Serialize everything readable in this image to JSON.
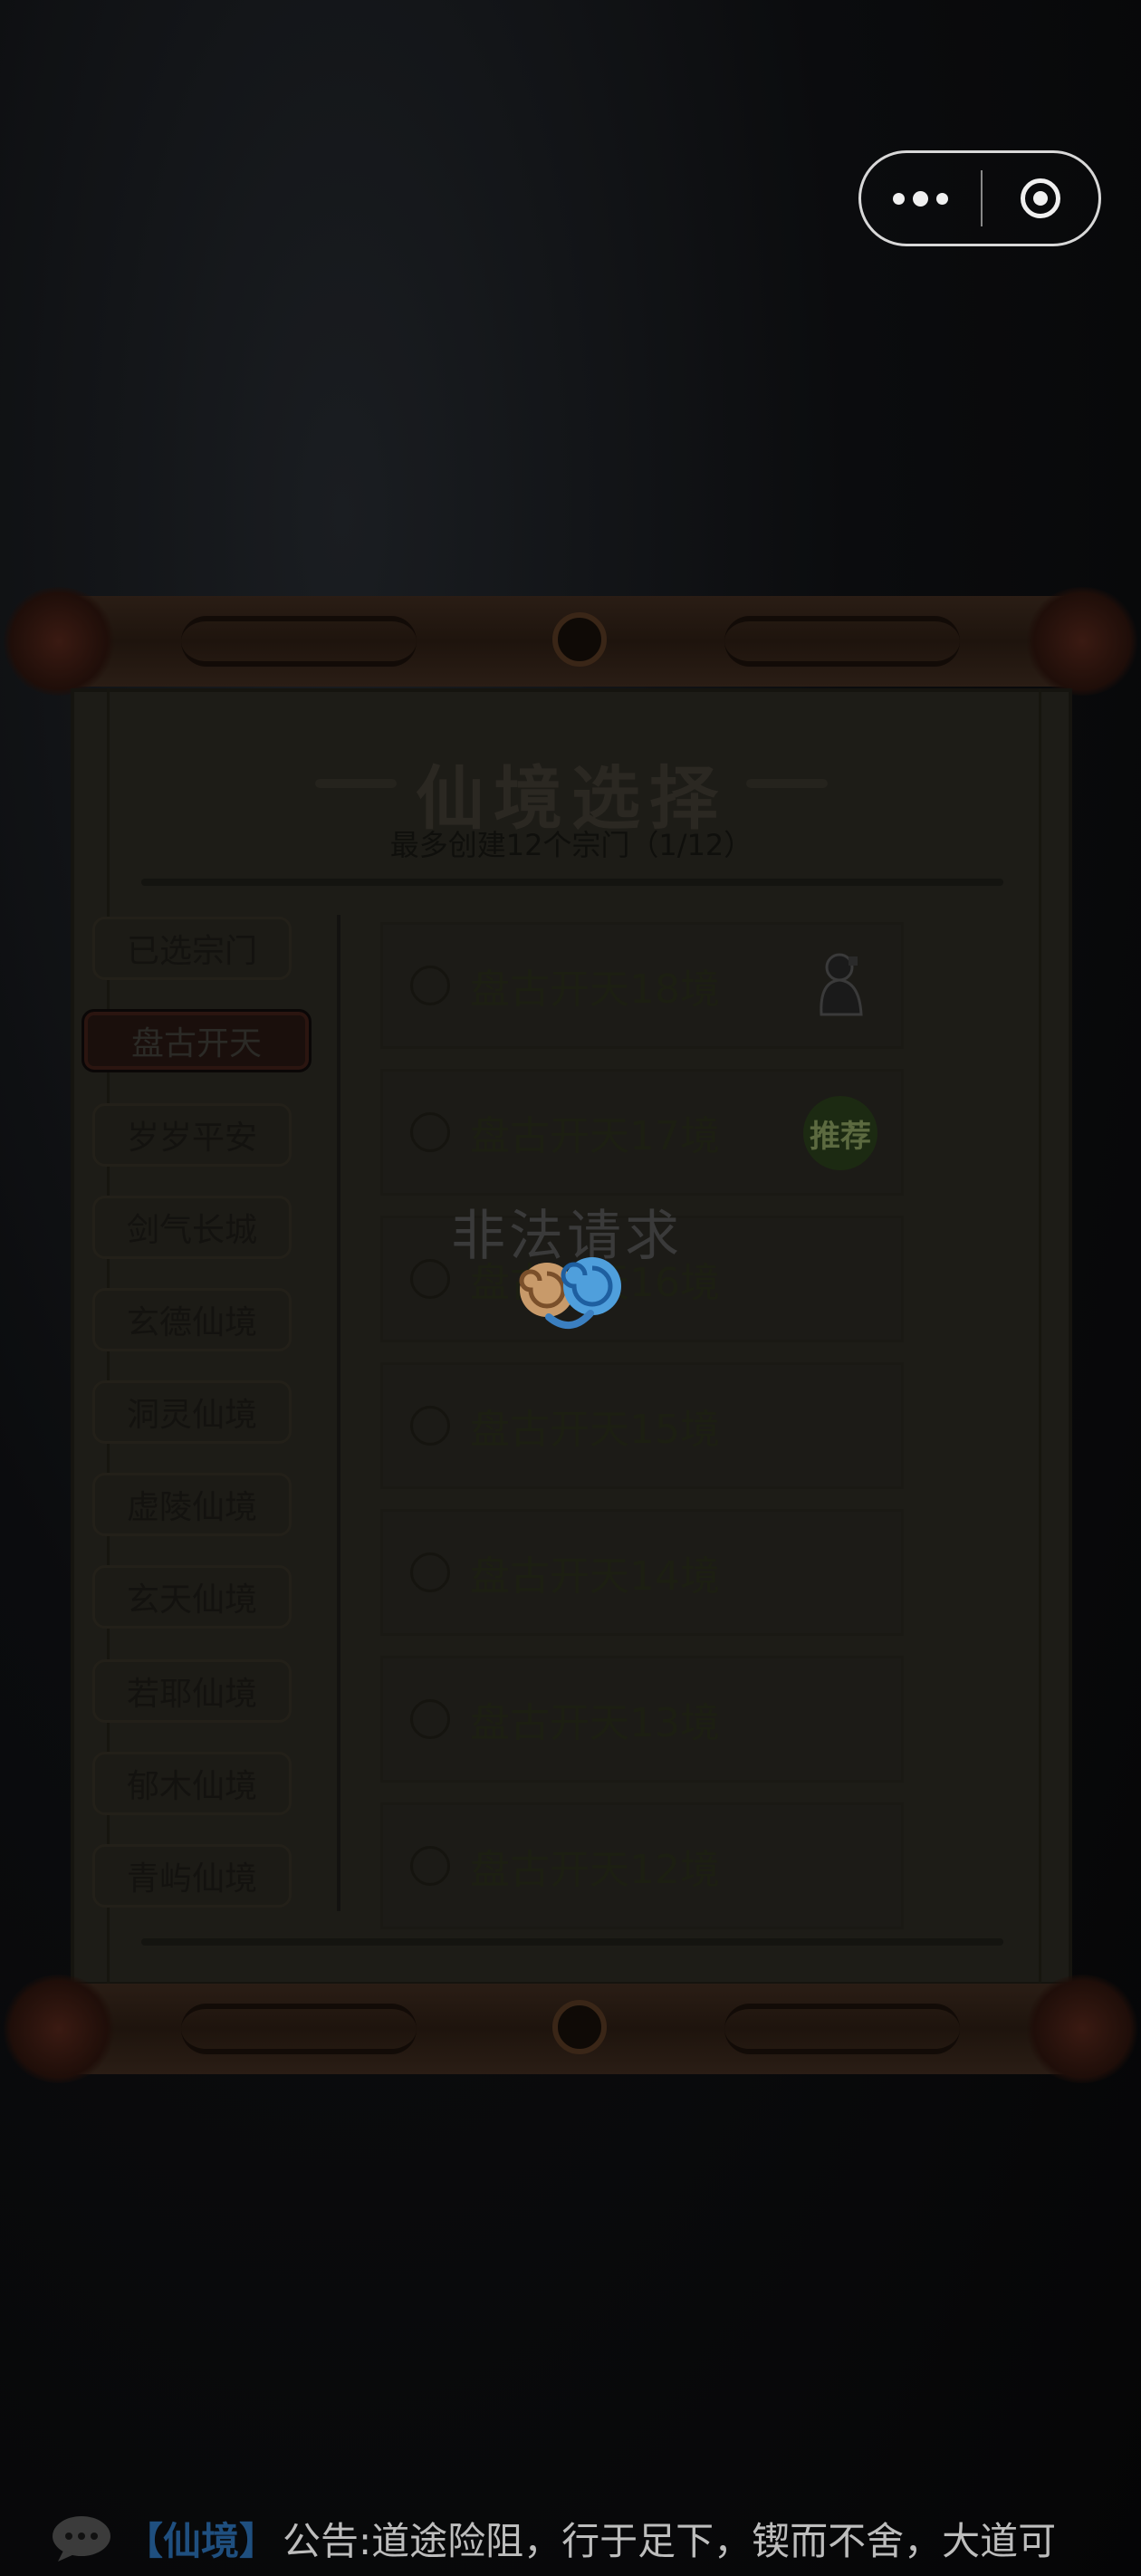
{
  "panel": {
    "title": "仙境选择",
    "subtitle": "最多创建12个宗门（1/12）"
  },
  "tabs": [
    {
      "label": "已选宗门",
      "active": false
    },
    {
      "label": "盘古开天",
      "active": true
    },
    {
      "label": "岁岁平安",
      "active": false
    },
    {
      "label": "剑气长城",
      "active": false
    },
    {
      "label": "玄德仙境",
      "active": false
    },
    {
      "label": "洞灵仙境",
      "active": false
    },
    {
      "label": "虚陵仙境",
      "active": false
    },
    {
      "label": "玄天仙境",
      "active": false
    },
    {
      "label": "若耶仙境",
      "active": false
    },
    {
      "label": "郁木仙境",
      "active": false
    },
    {
      "label": "青屿仙境",
      "active": false
    }
  ],
  "realms": [
    {
      "name": "盘古开天18境",
      "badge": "",
      "icon": "character-figure-icon"
    },
    {
      "name": "盘古开天17境",
      "badge": "推荐",
      "icon": "recommend-badge-icon"
    },
    {
      "name": "盘古开天16境",
      "badge": "",
      "icon": ""
    },
    {
      "name": "盘古开天15境",
      "badge": "",
      "icon": ""
    },
    {
      "name": "盘古开天14境",
      "badge": "",
      "icon": ""
    },
    {
      "name": "盘古开天13境",
      "badge": "",
      "icon": ""
    },
    {
      "name": "盘古开天12境",
      "badge": "",
      "icon": ""
    }
  ],
  "toast": {
    "message": "非法请求",
    "icon": "auspicious-cloud-icon"
  },
  "notice": {
    "icon": "chat-bubble-icon",
    "tag": "【仙境】",
    "text": "公告:道途险阻，行于足下，锲而不舍，大道可"
  },
  "colors": {
    "background": "#000000",
    "panel_paper": "#1d1c17",
    "active_tab": "#1a0f0c",
    "notice_tag": "#1f4f7f",
    "toast_text": "#3a3a3a"
  }
}
